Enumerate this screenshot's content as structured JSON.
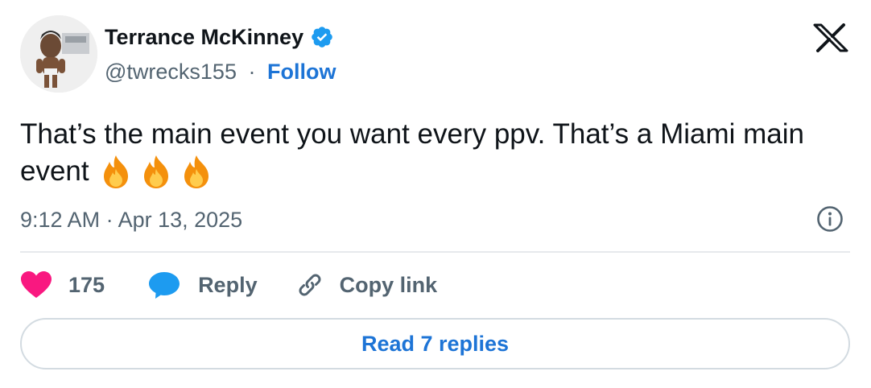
{
  "author": {
    "name": "Terrance McKinney",
    "handle": "@twrecks155",
    "separator": "·",
    "follow_label": "Follow"
  },
  "tweet": {
    "text": "That’s the main event you want every ppv. That’s a Miami main event",
    "emojis": [
      "fire-emoji",
      "fire-emoji",
      "fire-emoji"
    ],
    "timestamp": "9:12 AM · Apr 13, 2025"
  },
  "actions": {
    "like_count": "175",
    "reply_label": "Reply",
    "copy_label": "Copy link"
  },
  "footer": {
    "read_replies_label": "Read 7 replies"
  },
  "colors": {
    "accent": "#1d74d6",
    "verified": "#1d9bf0",
    "like": "#f91880",
    "reply": "#1d9bf0",
    "muted": "#536471"
  }
}
